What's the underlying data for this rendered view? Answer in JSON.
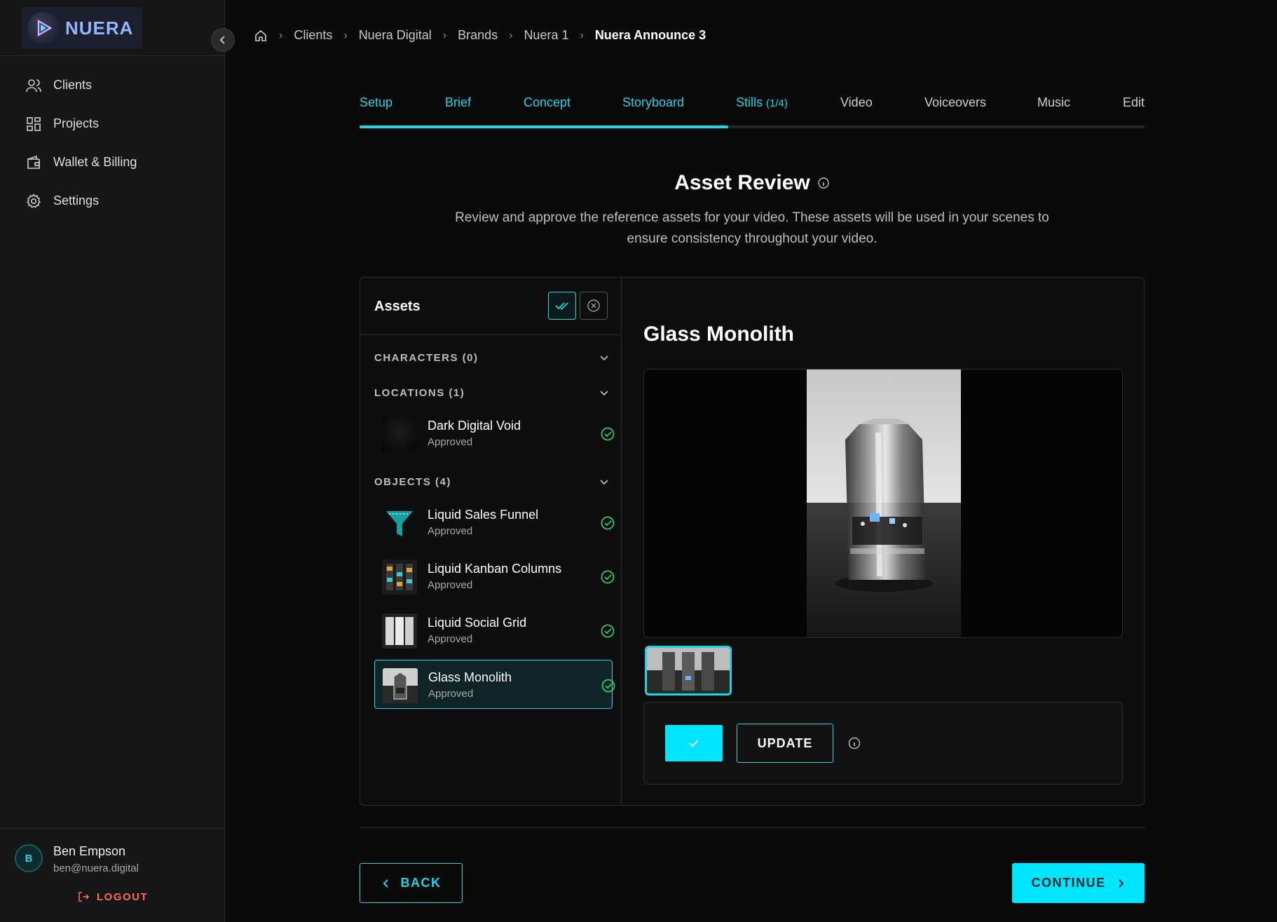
{
  "app": {
    "logo_text": "NUERA"
  },
  "sidebar": {
    "items": [
      {
        "label": "Clients",
        "icon": "users-icon"
      },
      {
        "label": "Projects",
        "icon": "grid-icon"
      },
      {
        "label": "Wallet & Billing",
        "icon": "wallet-icon"
      },
      {
        "label": "Settings",
        "icon": "gear-icon"
      }
    ],
    "user": {
      "initial": "B",
      "name": "Ben Empson",
      "email": "ben@nuera.digital",
      "logout_label": "LOGOUT"
    }
  },
  "breadcrumb": [
    "Clients",
    "Nuera Digital",
    "Brands",
    "Nuera 1",
    "Nuera Announce 3"
  ],
  "tabs": [
    {
      "label": "Setup",
      "state": "done"
    },
    {
      "label": "Brief",
      "state": "done"
    },
    {
      "label": "Concept",
      "state": "done"
    },
    {
      "label": "Storyboard",
      "state": "done"
    },
    {
      "label": "Stills",
      "count": "(1/4)",
      "state": "active"
    },
    {
      "label": "Video",
      "state": "todo"
    },
    {
      "label": "Voiceovers",
      "state": "todo"
    },
    {
      "label": "Music",
      "state": "todo"
    },
    {
      "label": "Edit",
      "state": "todo"
    }
  ],
  "progress_fraction": 0.47,
  "page": {
    "title": "Asset Review",
    "description": "Review and approve the reference assets for your video. These assets will be used in your scenes to ensure consistency throughout your video."
  },
  "assets": {
    "title": "Assets",
    "sections": {
      "characters": "CHARACTERS (0)",
      "locations": "LOCATIONS (1)",
      "objects": "OBJECTS (4)"
    },
    "locations": [
      {
        "name": "Dark Digital Void",
        "status": "Approved"
      }
    ],
    "objects": [
      {
        "name": "Liquid Sales Funnel",
        "status": "Approved"
      },
      {
        "name": "Liquid Kanban Columns",
        "status": "Approved"
      },
      {
        "name": "Liquid Social Grid",
        "status": "Approved"
      },
      {
        "name": "Glass Monolith",
        "status": "Approved"
      }
    ]
  },
  "detail": {
    "title": "Glass Monolith",
    "update_label": "UPDATE"
  },
  "footer": {
    "back_label": "BACK",
    "continue_label": "CONTINUE"
  },
  "colors": {
    "accent": "#00e5ff",
    "approved": "#2ecc71",
    "logout": "#ff6b57"
  }
}
